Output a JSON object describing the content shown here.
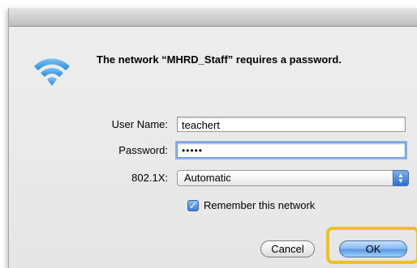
{
  "dialog": {
    "message": "The network “MHRD_Staff” requires a password.",
    "icon": "wifi-icon",
    "icon_color": "#3d9ee8"
  },
  "form": {
    "username_label": "User Name:",
    "username_value": "teachert",
    "password_label": "Password:",
    "password_value": "•••••",
    "security_label": "802.1X:",
    "security_value": "Automatic",
    "remember_label": "Remember this network",
    "remember_checked": true
  },
  "buttons": {
    "cancel_label": "Cancel",
    "ok_label": "OK"
  },
  "colors": {
    "ok_highlight": "#f0c020",
    "accent": "#3a7bd5"
  }
}
